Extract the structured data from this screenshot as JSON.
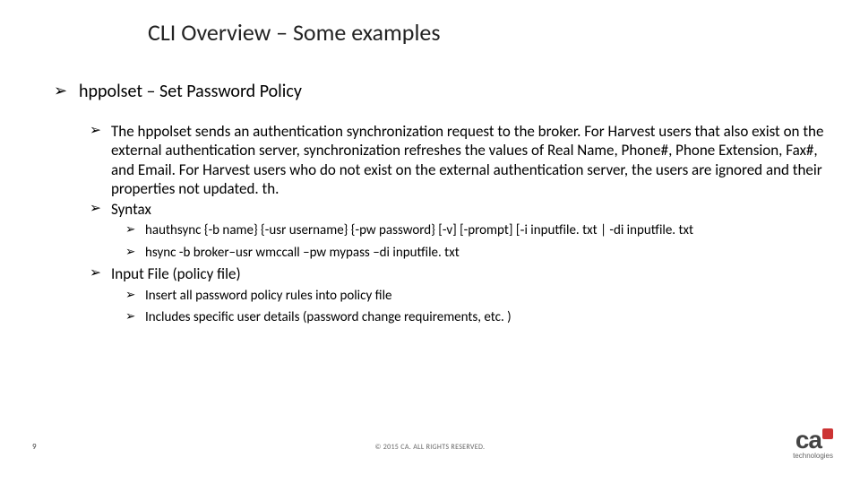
{
  "title": "CLI Overview – Some examples",
  "section": {
    "heading": "hppolset – Set Password Policy",
    "desc": "The hppolset sends an authentication synchronization request to the broker. For Harvest users that also exist on the external authentication server, synchronization refreshes the values of Real Name, Phone#, Phone Extension, Fax#, and Email. For Harvest users who do not exist on the external authentication server, the users are ignored and their properties not updated. th.",
    "syntax_label": "Syntax",
    "syntax_lines": [
      "hauthsync {-b name} {-usr username} {-pw password} [-v] [-prompt] [‑i inputfile. txt | -di inputfile. txt",
      "hsync -b broker–usr wmccall –pw mypass –di inputfile. txt"
    ],
    "input_file_label": "Input File (policy file)",
    "input_file_lines": [
      "Insert all password policy rules into policy file",
      "Includes specific user details (password change requirements, etc. )"
    ]
  },
  "footer": {
    "page": "9",
    "copyright": "© 2015 CA. ALL RIGHTS RESERVED.",
    "logo_main": "ca",
    "logo_sub": "technologies"
  }
}
